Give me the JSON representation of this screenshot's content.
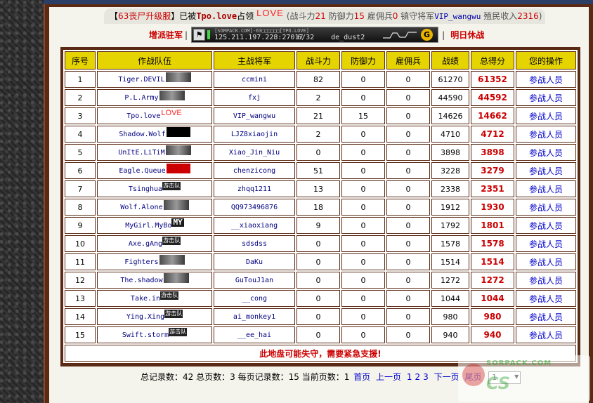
{
  "occupation": {
    "server_prefix": "【",
    "server_name": "63丧尸升级服",
    "server_suffix": "】已被",
    "occupier": "Tpo.love",
    "occupied_word": "占领",
    "logo_text": "LOVE",
    "stats_open": "(战斗力",
    "combat": "21",
    "defense_label": " 防御力",
    "defense": "15",
    "merc_label": " 雇佣兵",
    "merc": "0",
    "general_label": " 镇守将军",
    "general": "VIP_wangwu",
    "income_label": " 殖民收入",
    "income": "2316",
    "stats_close": ")"
  },
  "actions": {
    "reinforce": "增派驻军",
    "tomorrow": "明日休战",
    "separator": "|"
  },
  "server_banner": {
    "title": "[SORPACK.COM]-63□□□□□□[TPO.LOVE]",
    "address": "125.211.197.228:27017",
    "players": "6/32",
    "map": "de_dust2"
  },
  "table": {
    "headers": [
      "序号",
      "作战队伍",
      "主战将军",
      "战斗力",
      "防御力",
      "雇佣兵",
      "战绩",
      "总得分",
      "您的操作"
    ],
    "rows": [
      {
        "no": "1",
        "team": "Tiger.DEVIL",
        "general": "ccmini",
        "combat": "82",
        "defense": "0",
        "merc": "0",
        "record": "61270",
        "total": "61352",
        "op": "参战人员",
        "logo": "pic"
      },
      {
        "no": "2",
        "team": "P.L.Army",
        "general": "fxj",
        "combat": "2",
        "defense": "0",
        "merc": "0",
        "record": "44590",
        "total": "44592",
        "op": "参战人员",
        "logo": "pic"
      },
      {
        "no": "3",
        "team": "Tpo.love",
        "general": "VIP_wangwu",
        "combat": "21",
        "defense": "15",
        "merc": "0",
        "record": "14626",
        "total": "14662",
        "op": "参战人员",
        "logo": "love"
      },
      {
        "no": "4",
        "team": "Shadow.Wolf",
        "general": "LJZ8xiaojin",
        "combat": "2",
        "defense": "0",
        "merc": "0",
        "record": "4710",
        "total": "4712",
        "op": "参战人员",
        "logo": "black"
      },
      {
        "no": "5",
        "team": "UnItE.LiTiM",
        "general": "Xiao_Jin_Niu",
        "combat": "0",
        "defense": "0",
        "merc": "0",
        "record": "3898",
        "total": "3898",
        "op": "参战人员",
        "logo": "pic"
      },
      {
        "no": "6",
        "team": "Eagle.Queue",
        "general": "chenzicong",
        "combat": "51",
        "defense": "0",
        "merc": "0",
        "record": "3228",
        "total": "3279",
        "op": "参战人员",
        "logo": "red"
      },
      {
        "no": "7",
        "team": "Tsinghua",
        "general": "zhqq1211",
        "combat": "13",
        "defense": "0",
        "merc": "0",
        "record": "2338",
        "total": "2351",
        "op": "参战人员",
        "logo": "youji"
      },
      {
        "no": "8",
        "team": "Wolf.Alone",
        "general": "QQ973496876",
        "combat": "18",
        "defense": "0",
        "merc": "0",
        "record": "1912",
        "total": "1930",
        "op": "参战人员",
        "logo": "pic"
      },
      {
        "no": "9",
        "team": "MyGirl.MyBo",
        "general": "__xiaoxiang",
        "combat": "9",
        "defense": "0",
        "merc": "0",
        "record": "1792",
        "total": "1801",
        "op": "参战人员",
        "logo": "my"
      },
      {
        "no": "10",
        "team": "Axe.gAng",
        "general": "sdsdss",
        "combat": "0",
        "defense": "0",
        "merc": "0",
        "record": "1578",
        "total": "1578",
        "op": "参战人员",
        "logo": "youji"
      },
      {
        "no": "11",
        "team": "Fighters",
        "general": "DaKu",
        "combat": "0",
        "defense": "0",
        "merc": "0",
        "record": "1514",
        "total": "1514",
        "op": "参战人员",
        "logo": "pic"
      },
      {
        "no": "12",
        "team": "The.shadow",
        "general": "GuTouJ1an",
        "combat": "0",
        "defense": "0",
        "merc": "0",
        "record": "1272",
        "total": "1272",
        "op": "参战人员",
        "logo": "pic"
      },
      {
        "no": "13",
        "team": "Take.in",
        "general": "__cong",
        "combat": "0",
        "defense": "0",
        "merc": "0",
        "record": "1044",
        "total": "1044",
        "op": "参战人员",
        "logo": "youji"
      },
      {
        "no": "14",
        "team": "Ying.Xing",
        "general": "ai_monkey1",
        "combat": "0",
        "defense": "0",
        "merc": "0",
        "record": "980",
        "total": "980",
        "op": "参战人员",
        "logo": "youji"
      },
      {
        "no": "15",
        "team": "Swift.storm",
        "general": "__ee_hai",
        "combat": "0",
        "defense": "0",
        "merc": "0",
        "record": "940",
        "total": "940",
        "op": "参战人员",
        "logo": "youji"
      }
    ],
    "youji_label": "游击队",
    "my_label": "MY",
    "love_label": "LOVE",
    "warning": "此地盘可能失守，需要紧急支援!"
  },
  "pager": {
    "total_label": "总记录数：",
    "total": "42",
    "pages_label": " 总页数：",
    "pages": "3",
    "per_label": " 每页记录数：",
    "per": "15",
    "current_label": " 当前页数：",
    "current": "1",
    "first": "首页",
    "prev": "上一页",
    "p1": "1",
    "p2": "2",
    "p3": "3",
    "next": "下一页",
    "last": "尾页",
    "select_value": "1"
  },
  "watermark": {
    "top": "SORPACK.COM",
    "big": "CS"
  },
  "colors": {
    "header_bg": "#e6d400",
    "frame": "#5a2a14",
    "score_red": "#cc0000",
    "link_blue": "#0000cc"
  }
}
